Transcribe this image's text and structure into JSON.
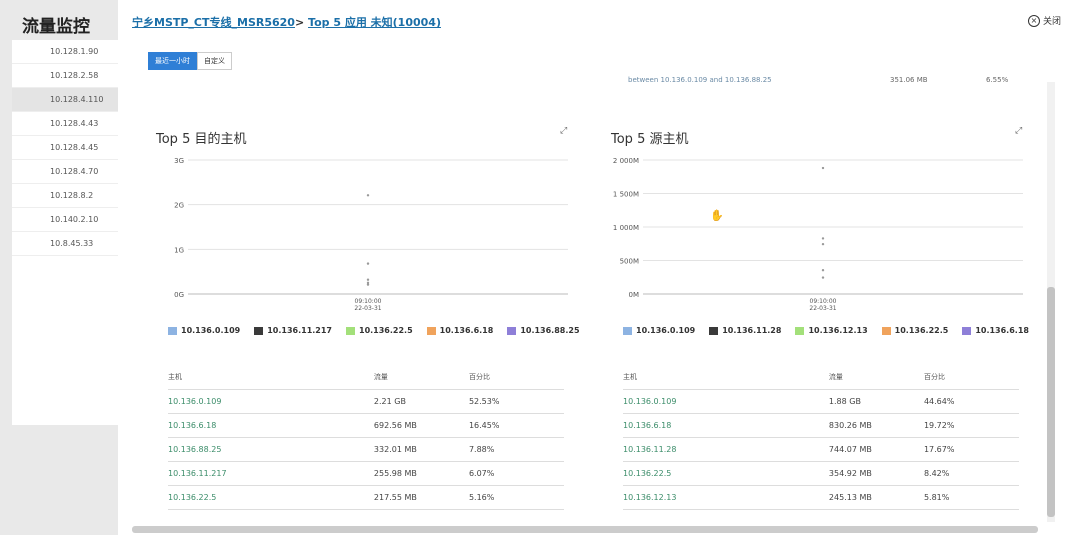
{
  "background": {
    "title": "流量监控",
    "ips": [
      "10.128.1.90",
      "10.128.2.58",
      "10.128.4.110",
      "10.128.4.43",
      "10.128.4.45",
      "10.128.4.70",
      "10.128.8.2",
      "10.140.2.10",
      "10.8.45.33"
    ],
    "active_index": 2
  },
  "header": {
    "crumb_link": "宁乡MSTP_CT专线_MSR5620",
    "separator": ">",
    "crumb_current": "Top 5 应用 未知(10004)",
    "close_label": "关闭"
  },
  "range": {
    "recent_hour": "最近一小时",
    "custom": "自定义"
  },
  "scroll_row": {
    "text": "between 10.136.0.109 and 10.136.88.25",
    "value": "351.06 MB",
    "percent": "6.55%"
  },
  "colors": {
    "series": [
      "#8db3e2",
      "#3a3a3a",
      "#a3e07a",
      "#f0a35c",
      "#8e7fd8"
    ]
  },
  "panels": [
    {
      "title": "Top 5 目的主机",
      "y_ticks": [
        "3G",
        "2G",
        "1G",
        "0G"
      ],
      "x_tick": "09:10:00",
      "x_tick_date": "22-03-31",
      "legend": [
        "10.136.0.109",
        "10.136.11.217",
        "10.136.22.5",
        "10.136.6.18",
        "10.136.88.25"
      ],
      "table": {
        "headers": [
          "主机",
          "流量",
          "百分比"
        ],
        "rows": [
          [
            "10.136.0.109",
            "2.21 GB",
            "52.53%"
          ],
          [
            "10.136.6.18",
            "692.56 MB",
            "16.45%"
          ],
          [
            "10.136.88.25",
            "332.01 MB",
            "7.88%"
          ],
          [
            "10.136.11.217",
            "255.98 MB",
            "6.07%"
          ],
          [
            "10.136.22.5",
            "217.55 MB",
            "5.16%"
          ]
        ]
      }
    },
    {
      "title": "Top 5 源主机",
      "y_ticks": [
        "2 000M",
        "1 500M",
        "1 000M",
        "500M",
        "0M"
      ],
      "x_tick": "09:10:00",
      "x_tick_date": "22-03-31",
      "legend": [
        "10.136.0.109",
        "10.136.11.28",
        "10.136.12.13",
        "10.136.22.5",
        "10.136.6.18"
      ],
      "table": {
        "headers": [
          "主机",
          "流量",
          "百分比"
        ],
        "rows": [
          [
            "10.136.0.109",
            "1.88 GB",
            "44.64%"
          ],
          [
            "10.136.6.18",
            "830.26 MB",
            "19.72%"
          ],
          [
            "10.136.11.28",
            "744.07 MB",
            "17.67%"
          ],
          [
            "10.136.22.5",
            "354.92 MB",
            "8.42%"
          ],
          [
            "10.136.12.13",
            "245.13 MB",
            "5.81%"
          ]
        ]
      }
    }
  ],
  "chart_data": [
    {
      "type": "scatter",
      "title": "Top 5 目的主机",
      "x": [
        "09:10:00"
      ],
      "ylim": [
        0,
        3
      ],
      "series": [
        {
          "name": "10.136.0.109",
          "values": [
            2.21
          ]
        },
        {
          "name": "10.136.6.18",
          "values": [
            0.68
          ]
        },
        {
          "name": "10.136.88.25",
          "values": [
            0.32
          ]
        },
        {
          "name": "10.136.11.217",
          "values": [
            0.25
          ]
        },
        {
          "name": "10.136.22.5",
          "values": [
            0.21
          ]
        }
      ]
    },
    {
      "type": "scatter",
      "title": "Top 5 源主机",
      "x": [
        "09:10:00"
      ],
      "ylim": [
        0,
        2000
      ],
      "series": [
        {
          "name": "10.136.0.109",
          "values": [
            1880
          ]
        },
        {
          "name": "10.136.6.18",
          "values": [
            830
          ]
        },
        {
          "name": "10.136.11.28",
          "values": [
            744
          ]
        },
        {
          "name": "10.136.22.5",
          "values": [
            355
          ]
        },
        {
          "name": "10.136.12.13",
          "values": [
            245
          ]
        }
      ]
    }
  ]
}
